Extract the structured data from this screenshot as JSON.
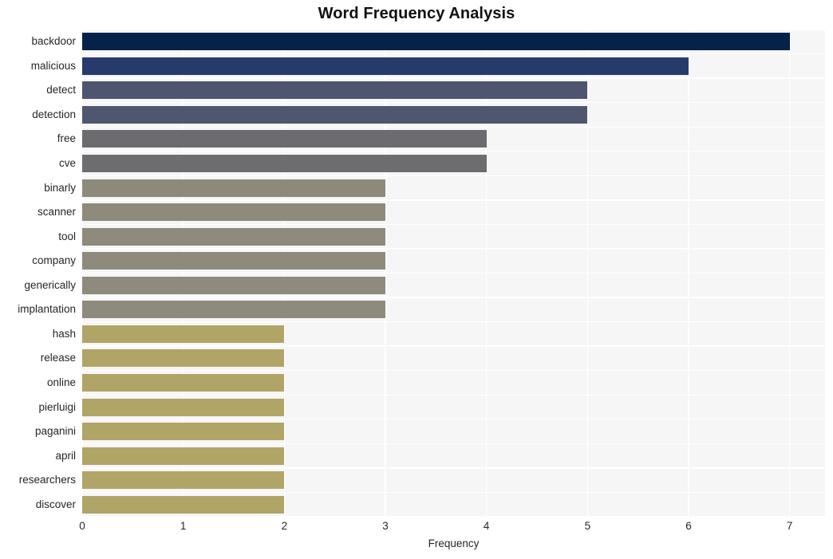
{
  "chart_data": {
    "type": "bar",
    "orientation": "horizontal",
    "title": "Word Frequency Analysis",
    "xlabel": "Frequency",
    "ylabel": "",
    "xlim": [
      0,
      7.35
    ],
    "xticks": [
      0,
      1,
      2,
      3,
      4,
      5,
      6,
      7
    ],
    "xtick_labels": [
      "0",
      "1",
      "2",
      "3",
      "4",
      "5",
      "6",
      "7"
    ],
    "grid": true,
    "legend": false,
    "categories": [
      "backdoor",
      "malicious",
      "detect",
      "detection",
      "free",
      "cve",
      "binarly",
      "scanner",
      "tool",
      "company",
      "generically",
      "implantation",
      "hash",
      "release",
      "online",
      "pierluigi",
      "paganini",
      "april",
      "researchers",
      "discover"
    ],
    "values": [
      7,
      6,
      5,
      5,
      4,
      4,
      3,
      3,
      3,
      3,
      3,
      3,
      2,
      2,
      2,
      2,
      2,
      2,
      2,
      2
    ],
    "bar_colors": [
      "#05224a",
      "#263b6b",
      "#4e5570",
      "#4f5670",
      "#6b6b70",
      "#6d6d70",
      "#8d8a7c",
      "#8e8b7c",
      "#8e8b7c",
      "#8e8b7c",
      "#8e8b7c",
      "#8e8b7c",
      "#b0a566",
      "#b0a566",
      "#b0a566",
      "#b0a566",
      "#b0a566",
      "#b0a566",
      "#b0a566",
      "#b0a566"
    ],
    "style": {
      "plot_background": "#f6f6f7",
      "figure_background": "#ffffff",
      "grid_color": "#ffffff",
      "text_color": "#262626"
    }
  }
}
